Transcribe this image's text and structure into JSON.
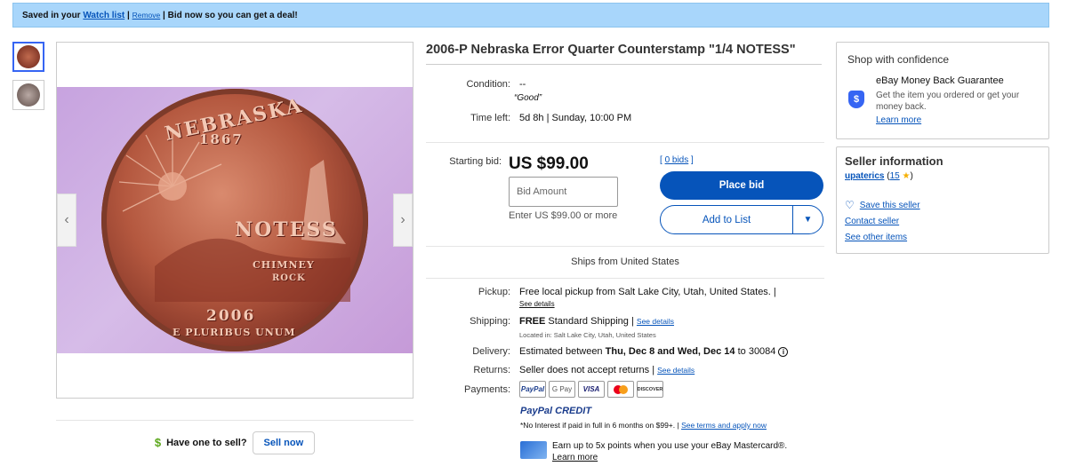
{
  "banner": {
    "prefix": "Saved in your",
    "watchlist_link": "Watch list",
    "sep1": "|",
    "remove_link": "Remove",
    "suffix": "| Bid now so you can get a deal!"
  },
  "gallery": {
    "coin_text": {
      "state": "NEBRASKA",
      "year_top": "1867",
      "stamp": "NOTESS",
      "chimney": "CHIMNEY",
      "rock": "ROCK",
      "year": "2006",
      "motto": "E PLURIBUS UNUM"
    }
  },
  "sell": {
    "label": "Have one to sell?",
    "button": "Sell now"
  },
  "item": {
    "title": "2006-P Nebraska Error Quarter Counterstamp \"1/4 NOTESS\"",
    "condition_label": "Condition:",
    "condition_value": "--",
    "condition_note": "“Good”",
    "time_left_label": "Time left:",
    "time_left_value": "5d 8h | Sunday, 10:00 PM",
    "starting_bid_label": "Starting bid:",
    "price": "US $99.00",
    "bids_link": "0 bids",
    "bid_placeholder": "Bid Amount",
    "bid_hint": "Enter US $99.00 or more",
    "place_bid": "Place bid",
    "add_to_list": "Add to List",
    "ships_from": "Ships from United States"
  },
  "details": {
    "pickup_label": "Pickup:",
    "pickup_value": "Free local pickup from Salt Lake City, Utah, United States. |",
    "see_details": "See details",
    "shipping_label": "Shipping:",
    "shipping_free": "FREE",
    "shipping_value": "Standard Shipping |",
    "located": "Located in: Salt Lake City, Utah, United States",
    "delivery_label": "Delivery:",
    "delivery_pre": "Estimated between",
    "delivery_dates": "Thu, Dec 8 and Wed, Dec 14",
    "delivery_post": "to 30084",
    "returns_label": "Returns:",
    "returns_value": "Seller does not accept returns |",
    "payments_label": "Payments:",
    "paypal_credit": "PayPal CREDIT",
    "no_interest": "*No Interest if paid in full in 6 months on $99+. |",
    "see_terms": "See terms and apply now",
    "mastercard_text": "Earn up to 5x points when you use your eBay Mastercard®.",
    "learn_more": "Learn more"
  },
  "payments": [
    "PayPal",
    "G Pay",
    "VISA",
    "mastercard",
    "DISCOVER"
  ],
  "confidence": {
    "heading": "Shop with confidence",
    "guarantee_title": "eBay Money Back Guarantee",
    "guarantee_desc": "Get the item you ordered or get your money back.",
    "learn_more": "Learn more"
  },
  "seller": {
    "heading": "Seller information",
    "username": "upaterics",
    "feedback": "15",
    "save": "Save this seller",
    "contact": "Contact seller",
    "other": "See other items"
  }
}
